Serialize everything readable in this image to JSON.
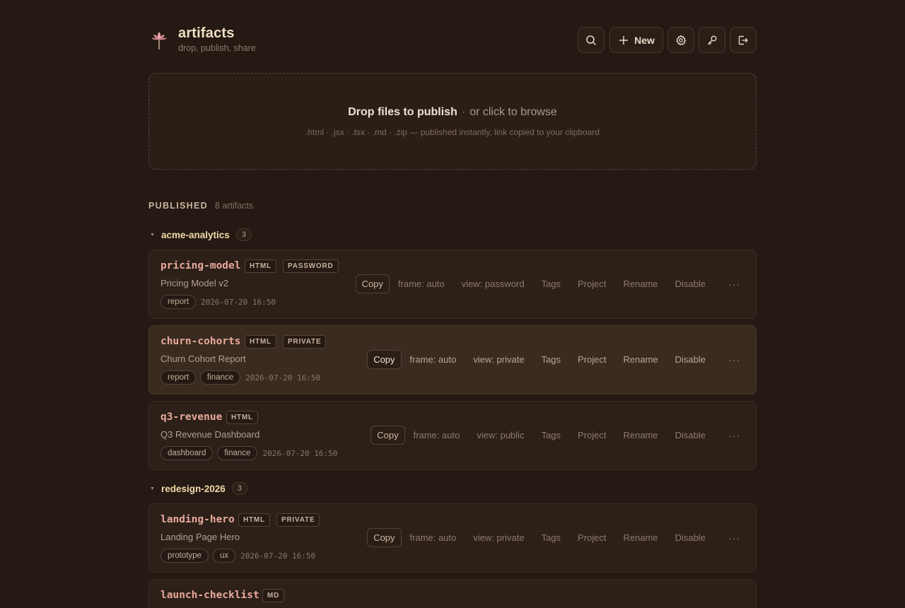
{
  "app": {
    "title": "artifacts",
    "subtitle": "drop, publish, share"
  },
  "header": {
    "new_label": "New"
  },
  "dropzone": {
    "main": "Drop files to publish",
    "separator": "·",
    "browse": "or click to browse",
    "hint": ".html · .jsx · .tsx · .md · .zip — published instantly, link copied to your clipboard"
  },
  "section": {
    "title": "PUBLISHED",
    "count": "8 artifacts"
  },
  "groups": [
    {
      "name": "acme-analytics",
      "count": "3",
      "caret": "▼",
      "items": [
        {
          "name": "pricing-model",
          "badges": [
            "HTML",
            "PASSWORD"
          ],
          "description": "Pricing Model v2",
          "tags": [
            "report"
          ],
          "date": "2026-07-20 16:50",
          "actions": {
            "copy": "Copy",
            "frame": "frame: auto",
            "view": "view: password",
            "tags": "Tags",
            "project": "Project",
            "rename": "Rename",
            "disable": "Disable",
            "more": "···"
          }
        },
        {
          "name": "churn-cohorts",
          "badges": [
            "HTML",
            "PRIVATE"
          ],
          "description": "Churn Cohort Report",
          "tags": [
            "report",
            "finance"
          ],
          "date": "2026-07-20 16:50",
          "actions": {
            "copy": "Copy",
            "frame": "frame: auto",
            "view": "view: private",
            "tags": "Tags",
            "project": "Project",
            "rename": "Rename",
            "disable": "Disable",
            "more": "···"
          }
        },
        {
          "name": "q3-revenue",
          "badges": [
            "HTML"
          ],
          "description": "Q3 Revenue Dashboard",
          "tags": [
            "dashboard",
            "finance"
          ],
          "date": "2026-07-20 16:50",
          "actions": {
            "copy": "Copy",
            "frame": "frame: auto",
            "view": "view: public",
            "tags": "Tags",
            "project": "Project",
            "rename": "Rename",
            "disable": "Disable",
            "more": "···"
          }
        }
      ]
    },
    {
      "name": "redesign-2026",
      "count": "3",
      "caret": "▼",
      "items": [
        {
          "name": "landing-hero",
          "badges": [
            "HTML",
            "PRIVATE"
          ],
          "description": "Landing Page Hero",
          "tags": [
            "prototype",
            "ux"
          ],
          "date": "2026-07-20 16:50",
          "actions": {
            "copy": "Copy",
            "frame": "frame: auto",
            "view": "view: private",
            "tags": "Tags",
            "project": "Project",
            "rename": "Rename",
            "disable": "Disable",
            "more": "···"
          }
        },
        {
          "name": "launch-checklist",
          "badges": [
            "MD"
          ]
        }
      ]
    }
  ],
  "colors": {
    "background": "#241913",
    "card": "#2c2019",
    "card_hover": "#3a2b20",
    "accent_name": "#e8a99b",
    "group_name": "#f1d9a8"
  },
  "icons": [
    "lotus-logo-icon",
    "search-icon",
    "plus-icon",
    "gear-icon",
    "key-icon",
    "logout-icon"
  ]
}
